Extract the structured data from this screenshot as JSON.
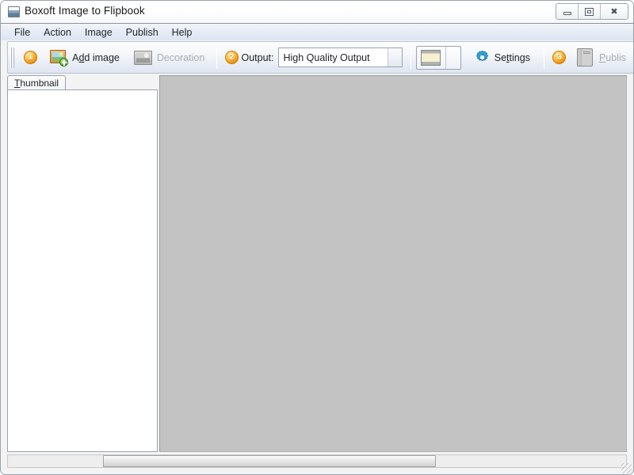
{
  "window": {
    "title": "Boxoft Image to Flipbook",
    "icon": "app-window-icon",
    "controls": {
      "minimize": "minimize-icon",
      "maximize": "maximize-icon",
      "close": "✖"
    }
  },
  "menubar": {
    "items": [
      {
        "label": "File"
      },
      {
        "label": "Action"
      },
      {
        "label": "Image"
      },
      {
        "label": "Publish"
      },
      {
        "label": "Help"
      }
    ]
  },
  "toolbar": {
    "step1_badge": "1",
    "add_image": {
      "label_pre": "A",
      "label_key": "d",
      "label_post": "d image",
      "icon": "add-image-icon"
    },
    "decoration": {
      "label": "Decoration",
      "icon": "decoration-icon",
      "enabled": false
    },
    "step2_badge": "2",
    "output_label": "Output:",
    "output_value": "High Quality Output",
    "output_options": [
      "High Quality Output"
    ],
    "template": {
      "icon": "page-template-icon"
    },
    "settings": {
      "label_pre": "Se",
      "label_key": "t",
      "label_post": "tings",
      "icon": "gear-icon"
    },
    "step3_badge": "3",
    "publish": {
      "label_pre": "",
      "label_key": "P",
      "label_post": "ublis",
      "icon": "book-icon",
      "enabled": false
    }
  },
  "leftpanel": {
    "tab": {
      "label_key": "T",
      "label_post": "humbnail"
    },
    "content": ""
  },
  "statusbar": {
    "scroll_thumb": "horizontal-scroll-thumb",
    "grip": "resize-grip"
  },
  "colors": {
    "accent_badge": "#f09410",
    "workspace": "#c3c3c3",
    "menubar": "#e6ecf5",
    "panel": "#ffffff",
    "border": "#9aa3ae",
    "gear": "#2f9fd6"
  }
}
